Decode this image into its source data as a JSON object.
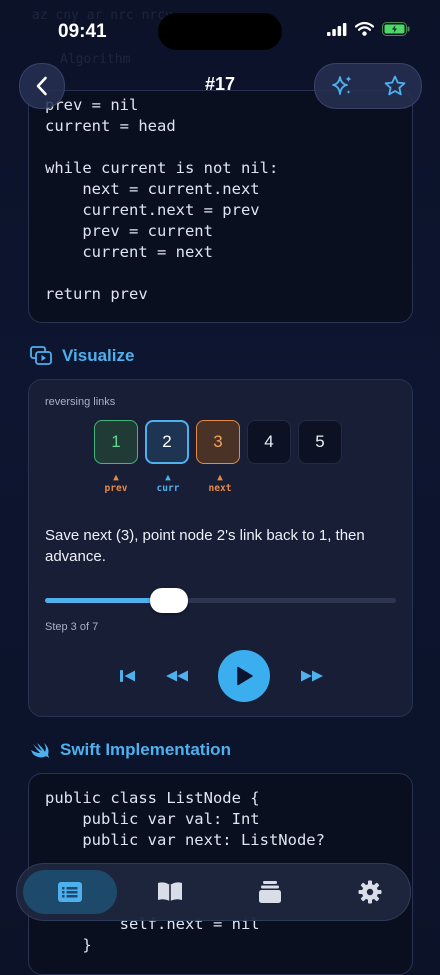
{
  "status_bar": {
    "time": "09:41"
  },
  "header": {
    "title": "#17",
    "back_icon": "chevron-left-icon",
    "action_icons": [
      "sparkles-icon",
      "star-icon"
    ]
  },
  "faded_text": [
    "az cny ar nrc nrcv",
    "Algorithm"
  ],
  "code_block": {
    "lines": [
      "prev = nil",
      "current = head",
      "",
      "while current is not nil:",
      "    next = current.next",
      "    current.next = prev",
      "    prev = current",
      "    current = next",
      "",
      "return prev"
    ]
  },
  "visualize": {
    "section_title": "Visualize",
    "label": "reversing links",
    "nodes": [
      "1",
      "2",
      "3",
      "4",
      "5"
    ],
    "pointers": {
      "prev": "prev",
      "curr": "curr",
      "next": "next"
    },
    "description": "Save next (3), point node 2's link back to 1, then advance.",
    "step_text": "Step 3 of 7",
    "progress": 0.35,
    "controls": [
      "skip-to-start-icon",
      "rewind-icon",
      "play-icon",
      "fast-forward-icon"
    ]
  },
  "swift": {
    "section_title": "Swift Implementation",
    "lines": [
      "public class ListNode {",
      "    public var val: Int",
      "    public var next: ListNode?",
      "",
      "",
      "",
      "        self.next = nil",
      "    }"
    ]
  },
  "tab_bar": {
    "tabs": [
      "list-icon",
      "book-icon",
      "stack-icon",
      "gear-icon"
    ],
    "active": 0
  },
  "colors": {
    "accent": "#4fb0ee",
    "prev": "#5ad991",
    "curr": "#4fb0ee",
    "next": "#f2a15f"
  }
}
